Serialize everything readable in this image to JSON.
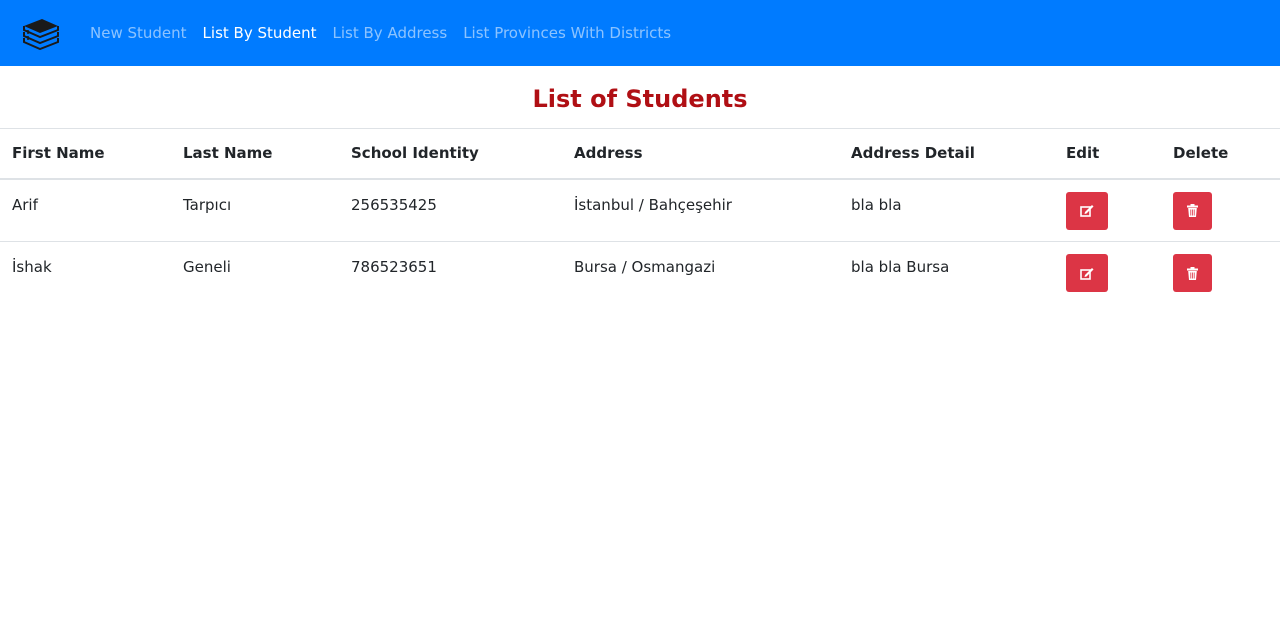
{
  "navbar": {
    "brand_icon": "books-stack-icon",
    "accent_color": "#007bff",
    "links": [
      {
        "label": "New Student",
        "active": false
      },
      {
        "label": "List By Student",
        "active": true
      },
      {
        "label": "List By Address",
        "active": false
      },
      {
        "label": "List Provinces With Districts",
        "active": false
      }
    ]
  },
  "page": {
    "title": "List of Students",
    "title_color": "#b00f14"
  },
  "table": {
    "headers": [
      "First Name",
      "Last Name",
      "School Identity",
      "Address",
      "Address Detail",
      "Edit",
      "Delete"
    ],
    "rows": [
      {
        "first_name": "Arif",
        "last_name": "Tarpıcı",
        "school_identity": "256535425",
        "address": "İstanbul / Bahçeşehir",
        "address_detail": "bla bla",
        "edit_icon": "edit-icon",
        "delete_icon": "trash-icon"
      },
      {
        "first_name": "İshak",
        "last_name": "Geneli",
        "school_identity": "786523651",
        "address": "Bursa / Osmangazi",
        "address_detail": "bla bla Bursa",
        "edit_icon": "edit-icon",
        "delete_icon": "trash-icon"
      }
    ],
    "button_color": "#dc3545"
  }
}
